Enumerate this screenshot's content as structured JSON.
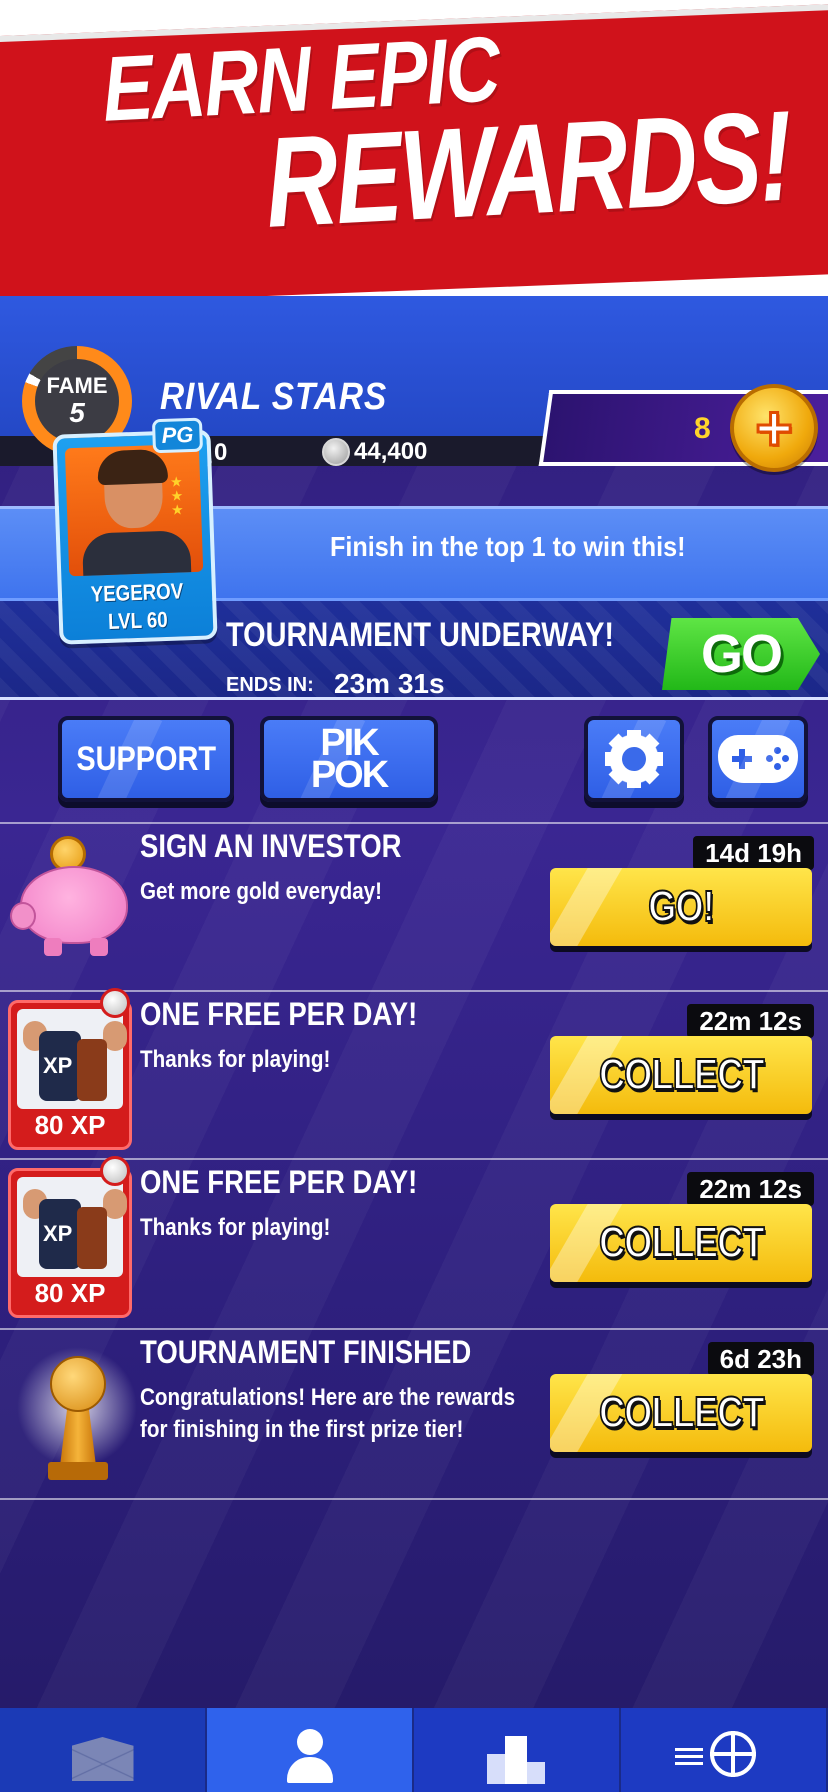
{
  "banner": {
    "line1": "EARN EPIC",
    "line2": "REWARDS!"
  },
  "header": {
    "fame_label": "FAME",
    "fame_level": "5",
    "player_name": "RIVAL STARS",
    "fans": "0",
    "coins": "44,400",
    "gold": "8"
  },
  "tournament": {
    "message": "Finish in the top 1 to win this!",
    "title": "TOURNAMENT UNDERWAY!",
    "ends_label": "ENDS IN:",
    "ends_time": "23m 31s",
    "go_label": "GO"
  },
  "player_card": {
    "position": "PG",
    "name": "YEGEROV",
    "level": "LVL 60"
  },
  "buttons": {
    "support": "SUPPORT",
    "pikpok_line1": "PIK",
    "pikpok_line2": "POK"
  },
  "rewards": [
    {
      "title": "SIGN AN INVESTOR",
      "subtitle": "Get more gold everyday!",
      "timer": "14d 19h",
      "button": "GO!"
    },
    {
      "title": "ONE FREE PER DAY!",
      "subtitle": "Thanks for playing!",
      "timer": "22m 12s",
      "button": "COLLECT",
      "badge": "80 XP",
      "card_text": "XP"
    },
    {
      "title": "ONE FREE PER DAY!",
      "subtitle": "Thanks for playing!",
      "timer": "22m 12s",
      "button": "COLLECT",
      "badge": "80 XP",
      "card_text": "XP"
    },
    {
      "title": "TOURNAMENT FINISHED",
      "subtitle_line1": "Congratulations! Here are the rewards",
      "subtitle_line2": "for finishing in the first prize tier!",
      "timer": "6d 23h",
      "button": "COLLECT"
    }
  ],
  "bottom_nav": {
    "tabs": [
      "mail-icon",
      "user-icon",
      "podium-icon",
      "basketball-icon"
    ],
    "active": "user-icon"
  },
  "colors": {
    "banner_red": "#d0121b",
    "header_blue": "#2f59e0",
    "go_green": "#22b818",
    "collect_yellow": "#f4bb0c",
    "background_purple": "#3a2692"
  }
}
